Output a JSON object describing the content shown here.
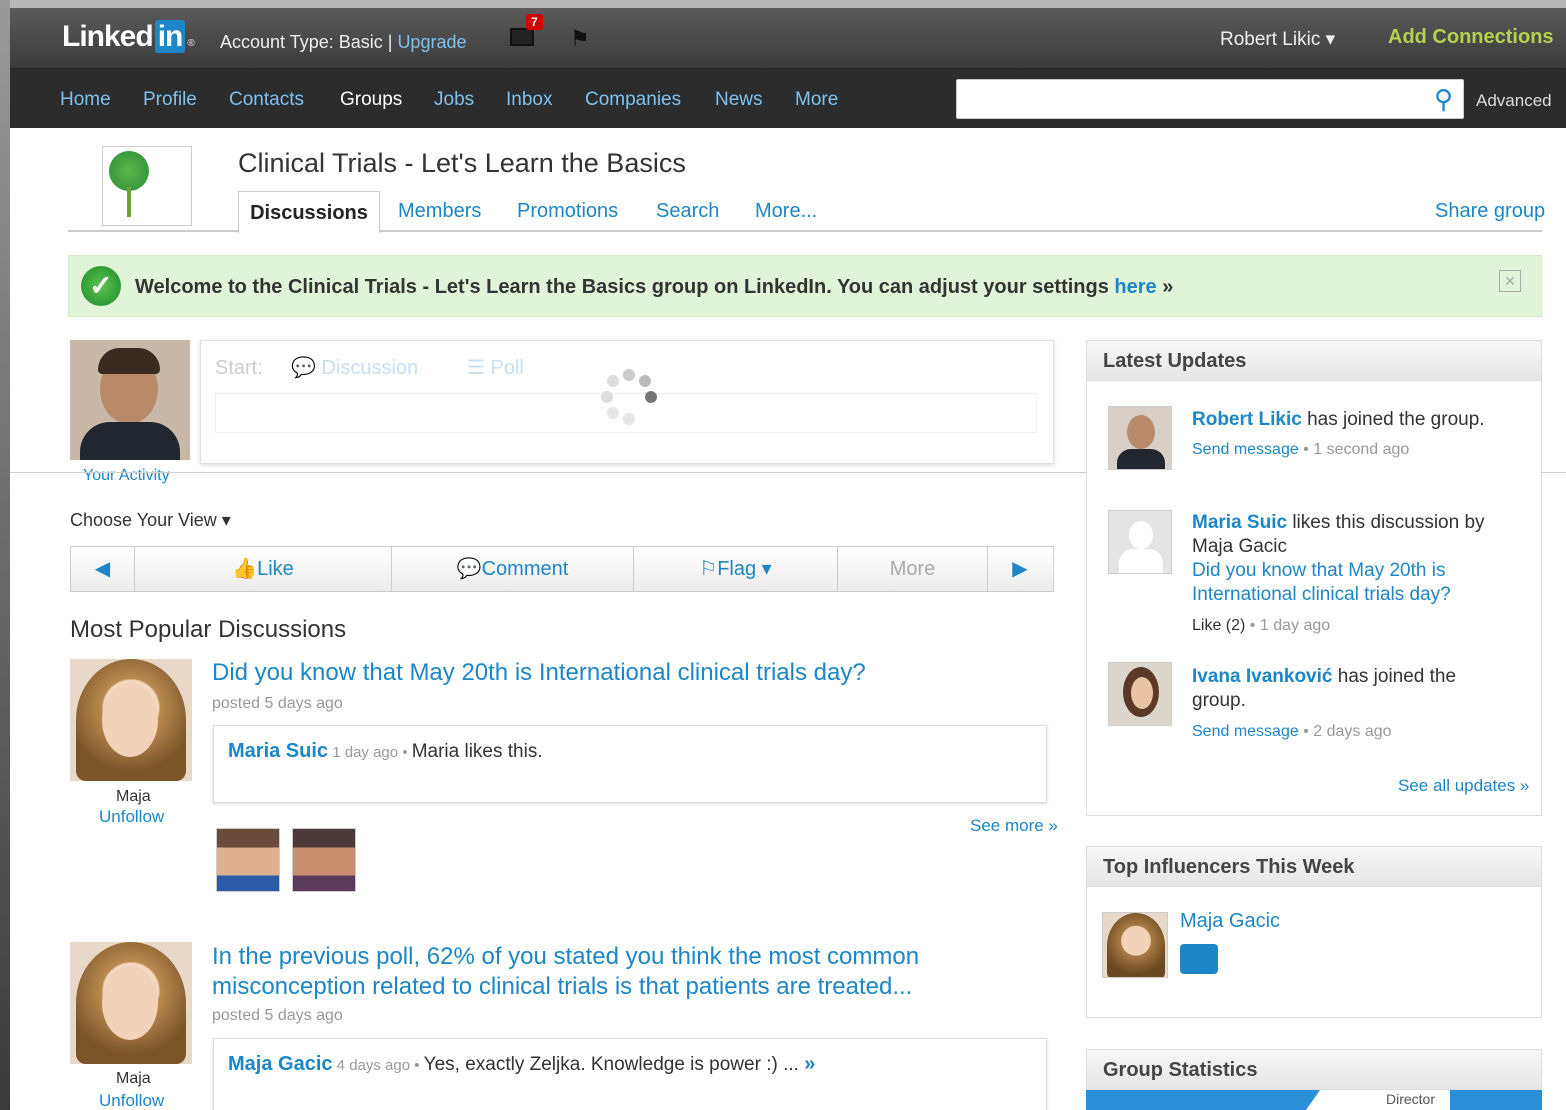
{
  "topbar": {
    "logo_text": "Linked",
    "logo_in": "in",
    "logo_reg": "®",
    "account_label": "Account Type: Basic | ",
    "upgrade_label": "Upgrade",
    "mail_badge": "7",
    "user_name": "Robert Likic",
    "user_caret": "▾",
    "add_connections": "Add Connections"
  },
  "nav": {
    "items": [
      "Home",
      "Profile",
      "Contacts",
      "Groups",
      "Jobs",
      "Inbox",
      "Companies",
      "News",
      "More"
    ],
    "search_placeholder": "",
    "advanced": "Advanced"
  },
  "group": {
    "title": "Clinical Trials - Let's Learn the Basics",
    "tabs": [
      "Discussions",
      "Members",
      "Promotions",
      "Search",
      "More..."
    ],
    "share": "Share group"
  },
  "welcome": {
    "text": "Welcome to the Clinical Trials - Let's Learn the Basics group on LinkedIn. You can adjust your settings ",
    "here": "here",
    "arrow": " »"
  },
  "composer": {
    "start": "Start:",
    "discussion": "Discussion",
    "poll": "Poll",
    "your_activity": "Your Activity"
  },
  "view": {
    "choose": "Choose Your View ▾",
    "like": "Like",
    "comment": "Comment",
    "flag": "Flag ▾",
    "more": "More"
  },
  "popular": {
    "heading": "Most Popular Discussions",
    "see_more": "See more »",
    "discussions": [
      {
        "title": "Did you know that May 20th is International clinical trials day?",
        "posted": "posted 5 days ago",
        "author": "Maja",
        "unfollow": "Unfollow",
        "comment_name": "Maria Suic",
        "comment_time": " 1 day ago • ",
        "comment_text": "Maria likes this."
      },
      {
        "title": "In the previous poll, 62% of you stated you think the most common misconception related to clinical trials is that patients are treated...",
        "posted": "posted 5 days ago",
        "author": "Maja",
        "unfollow": "Unfollow",
        "comment_name": "Maja Gacic",
        "comment_time": " 4 days ago • ",
        "comment_text": "Yes, exactly Zeljka. Knowledge is power :) ... ",
        "comment_more": "»"
      }
    ]
  },
  "latest_updates": {
    "heading": "Latest Updates",
    "items": [
      {
        "name": "Robert Likic",
        "text": " has joined the group.",
        "action": "Send message",
        "time": " • 1 second ago"
      },
      {
        "name": "Maria Suic",
        "text": " likes this discussion by Maja Gacic",
        "link": "Did you know that May 20th is International clinical trials day?",
        "action": "Like (2)",
        "time": " • 1 day ago"
      },
      {
        "name": "Ivana Ivanković",
        "text": " has joined the group.",
        "action": "Send message",
        "time": " • 2 days ago"
      }
    ],
    "see_all": "See all updates »"
  },
  "influencers": {
    "heading": "Top Influencers This Week",
    "name": "Maja Gacic"
  },
  "stats": {
    "heading": "Group Statistics",
    "label": "Director"
  },
  "colors": {
    "link": "#1c86c6",
    "topbar": "#3b3b3b",
    "navbar": "#2c2c2c",
    "accent_green": "#b6d14d",
    "welcome_bg": "#e2f4d7"
  }
}
